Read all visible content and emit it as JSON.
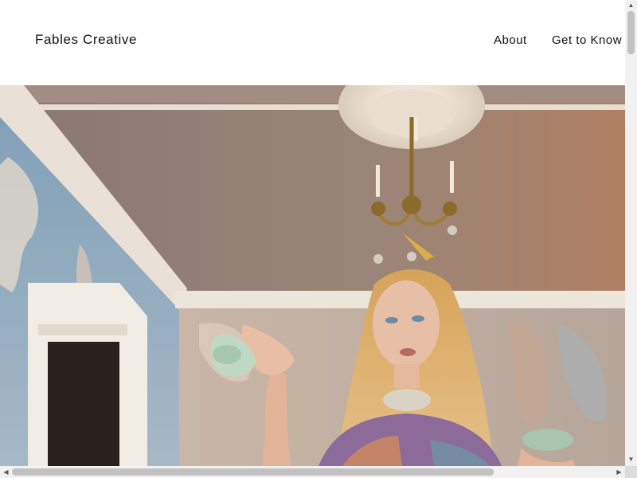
{
  "header": {
    "brand": "Fables Creative",
    "nav": [
      "About",
      "Get to Know"
    ]
  },
  "hero": {
    "image": "photo-of-woman-with-teacups-under-chandelier"
  },
  "scrollbars": {
    "up": "▲",
    "down": "▼",
    "left": "◀",
    "right": "▶"
  }
}
